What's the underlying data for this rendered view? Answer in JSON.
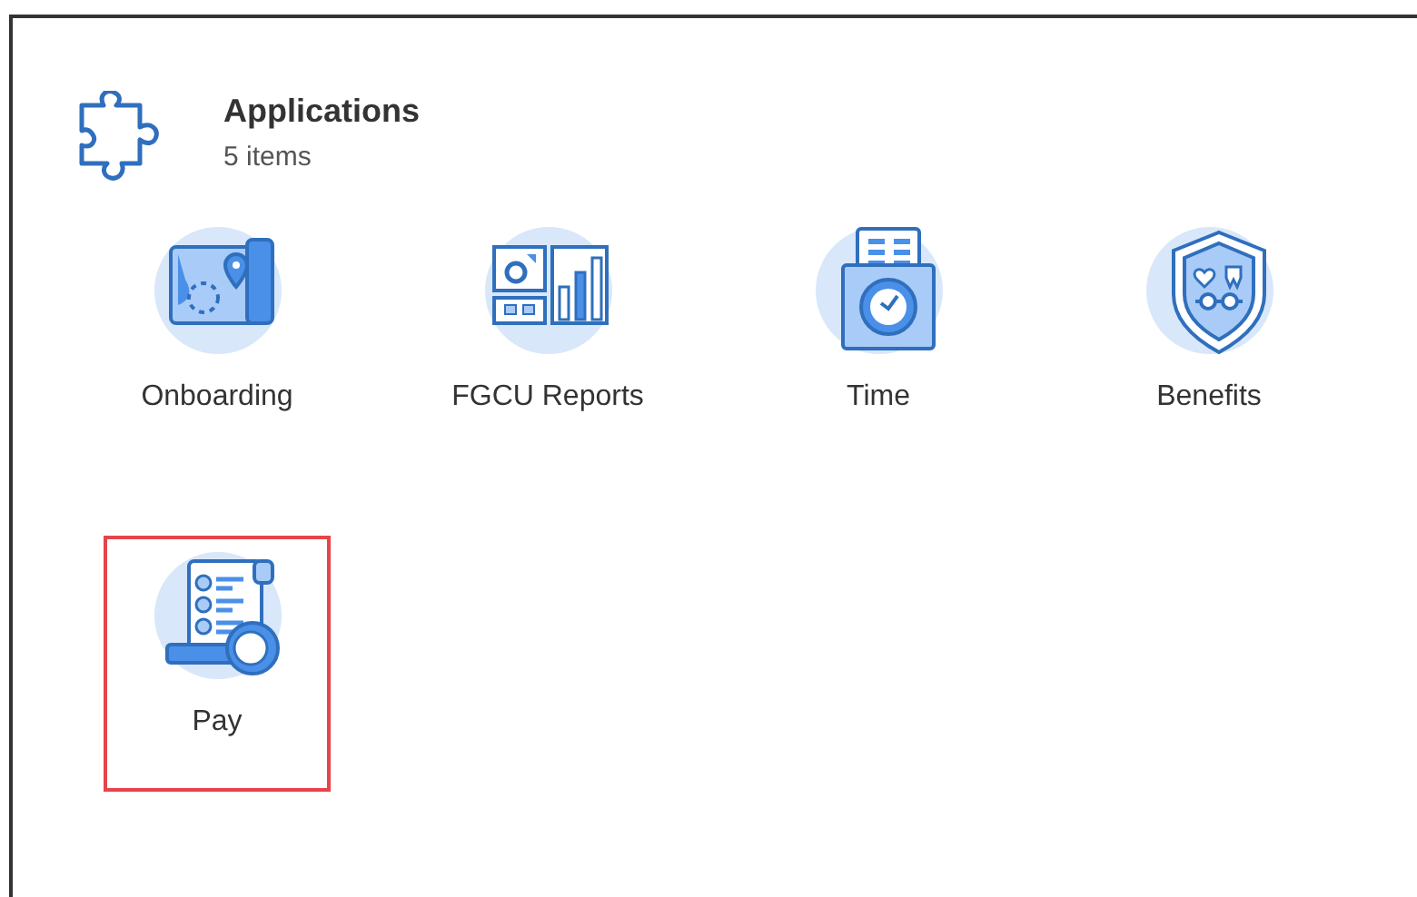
{
  "header": {
    "title": "Applications",
    "count": "5 items"
  },
  "apps": [
    {
      "label": "Onboarding",
      "kind": "map",
      "highlighted": false
    },
    {
      "label": "FGCU Reports",
      "kind": "reports",
      "highlighted": false
    },
    {
      "label": "Time",
      "kind": "time",
      "highlighted": false
    },
    {
      "label": "Benefits",
      "kind": "benefits",
      "highlighted": false
    },
    {
      "label": "Pay",
      "kind": "pay",
      "highlighted": true
    }
  ]
}
